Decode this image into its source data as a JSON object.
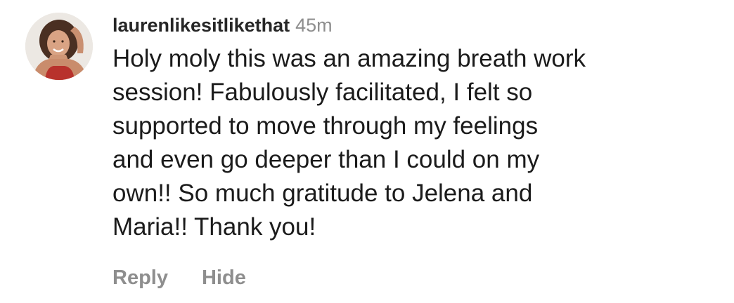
{
  "comment": {
    "username": "laurenlikesitlikethat",
    "time_ago": "45m",
    "text_lines": [
      "Holy moly this was an amazing breath work",
      "session! Fabulously facilitated, I felt so",
      "supported to move through my feelings",
      "and even go deeper than I could on my",
      "own!! So much gratitude to Jelena and",
      "Maria!! Thank you!"
    ],
    "actions": {
      "reply_label": "Reply",
      "hide_label": "Hide"
    }
  }
}
